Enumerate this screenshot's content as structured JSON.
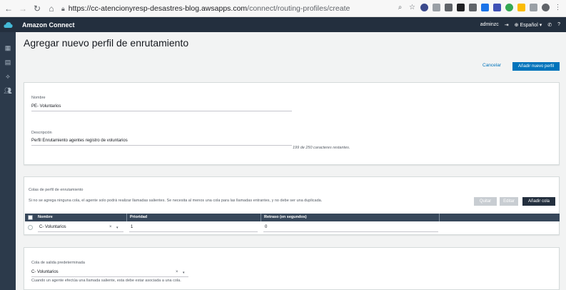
{
  "browser": {
    "url_host": "https://cc-atencionyresp-desastres-blog.awsapps.com",
    "url_path": "/connect/routing-profiles/create"
  },
  "app": {
    "title": "Amazon Connect",
    "user": "adminzc",
    "language": "Español",
    "help": "?"
  },
  "page": {
    "title": "Agregar nuevo perfil de enrutamiento",
    "cancel_label": "Cancelar",
    "add_label": "Añadir nuevo perfil"
  },
  "general": {
    "name_label": "Nombre",
    "name_value": "PE- Voluntarios",
    "description_label": "Descripción",
    "description_value": "Perfil Enrutamiento agentes registro de voluntarios",
    "remaining": "199 de 250 caracteres restantes."
  },
  "queues": {
    "section_label": "Colas de perfil de enrutamiento",
    "help_text": "Si no se agrega ninguna cola, el agente solo podrá realizar llamadas salientes. Se necesita al menos una cola para las llamadas entrantes, y no debe ser una duplicada.",
    "remove_label": "Quitar",
    "edit_label": "Editar",
    "add_label": "Añadir cola",
    "columns": [
      "Nombre",
      "Prioridad",
      "Retraso (en segundos)"
    ],
    "rows": [
      {
        "name": "C- Voluntarios",
        "priority": "1",
        "delay": "0"
      }
    ]
  },
  "outbound": {
    "label": "Cola de salida predeterminada",
    "value": "C- Voluntarios",
    "helper": "Cuando un agente efectúa una llamada saliente, esta debe estar asociada a una cola."
  },
  "colors": {
    "header_bg": "#232f3e",
    "primary": "#0073bb",
    "table_head": "#37475a",
    "page_bg": "#f2f3f3"
  }
}
